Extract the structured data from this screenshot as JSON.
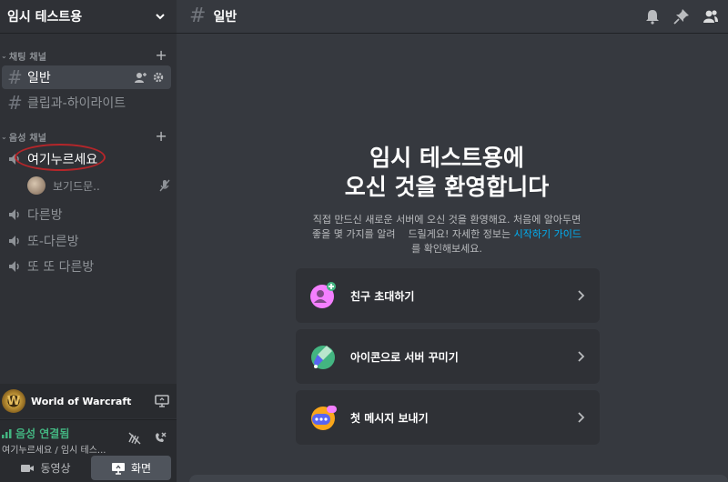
{
  "server": {
    "name": "임시 테스트용"
  },
  "categories": {
    "text": {
      "label": "채팅 채널"
    },
    "voice": {
      "label": "음성 채널"
    }
  },
  "text_channels": [
    {
      "name": "일반"
    },
    {
      "name": "클립과-하이라이트"
    }
  ],
  "voice_channels": [
    {
      "name": "여기누르세요"
    },
    {
      "name": "다른방"
    },
    {
      "name": "또-다른방"
    },
    {
      "name": "또 또 다른방"
    }
  ],
  "voice_member": {
    "name": "보기드문.."
  },
  "activity": {
    "name": "World of Warcraft",
    "logo_letter": "W"
  },
  "voice_panel": {
    "status": "음성 연결됨",
    "location": "여기누르세요 / 임시 테스..."
  },
  "bottom_buttons": {
    "video": "동영상",
    "screen": "화면"
  },
  "topbar": {
    "channel": "일반"
  },
  "welcome": {
    "title_line1": "임시 테스트용에",
    "title_line2": "오신 것을 환영합니다",
    "desc_line1": "직접 만드신 새로운 서버에 오신 것을 환영해요. 처음에 알아두면",
    "desc_line2": "좋을 몇 가지를 알려    드릴게요! 자세한 정보는",
    "desc_link": "시작하기 가이드",
    "desc_line3": "를 확인해보세요."
  },
  "cards": [
    {
      "label": "친구 초대하기",
      "icon": "invite-friend-icon"
    },
    {
      "label": "아이콘으로 서버 꾸미기",
      "icon": "customize-server-icon"
    },
    {
      "label": "첫 메시지 보내기",
      "icon": "send-message-icon"
    }
  ],
  "colors": {
    "accent_green": "#43b581",
    "link_blue": "#00b0f4",
    "annotation_red": "#b4262a"
  }
}
